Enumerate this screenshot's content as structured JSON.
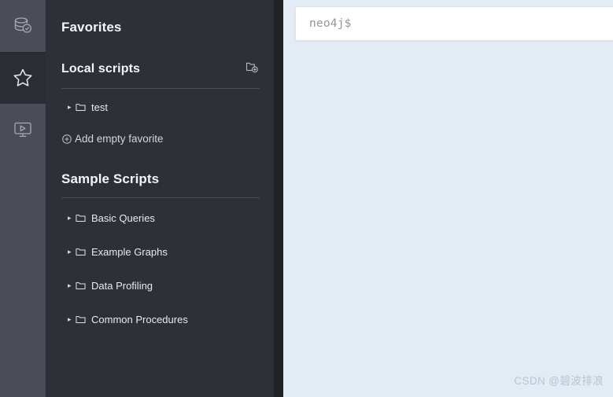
{
  "rail": {
    "items": [
      {
        "name": "database-icon",
        "label": "Database Information",
        "active": false
      },
      {
        "name": "star-icon",
        "label": "Favorites",
        "active": true
      },
      {
        "name": "monitor-play-icon",
        "label": "Project Files",
        "active": false
      }
    ]
  },
  "sidebar": {
    "title": "Favorites",
    "local_scripts": {
      "title": "Local scripts",
      "new_folder_icon": "folder-add-icon",
      "items": [
        {
          "label": "test",
          "icon": "folder-icon",
          "caret": "▸"
        }
      ],
      "add_favorite": {
        "label": "Add empty favorite",
        "icon": "circle-plus-icon"
      }
    },
    "sample_scripts": {
      "title": "Sample Scripts",
      "items": [
        {
          "label": "Basic Queries",
          "icon": "folder-icon",
          "caret": "▸"
        },
        {
          "label": "Example Graphs",
          "icon": "folder-icon",
          "caret": "▸"
        },
        {
          "label": "Data Profiling",
          "icon": "folder-icon",
          "caret": "▸"
        },
        {
          "label": "Common Procedures",
          "icon": "folder-icon",
          "caret": "▸"
        }
      ]
    }
  },
  "editor": {
    "prompt": "neo4j$",
    "value": "",
    "placeholder": ""
  },
  "watermark": {
    "text": "CSDN @碧波排浪"
  },
  "colors": {
    "rail_bg": "#4c4c58",
    "rail_active_bg": "#2b2d35",
    "sidebar_bg": "#2e3038",
    "sidebar_edge": "#202227",
    "main_bg": "#e3ebf4",
    "card_bg": "#ffffff",
    "divider": "#494c55",
    "prompt_text": "#8e959e",
    "watermark_text": "#b9c3d0"
  }
}
